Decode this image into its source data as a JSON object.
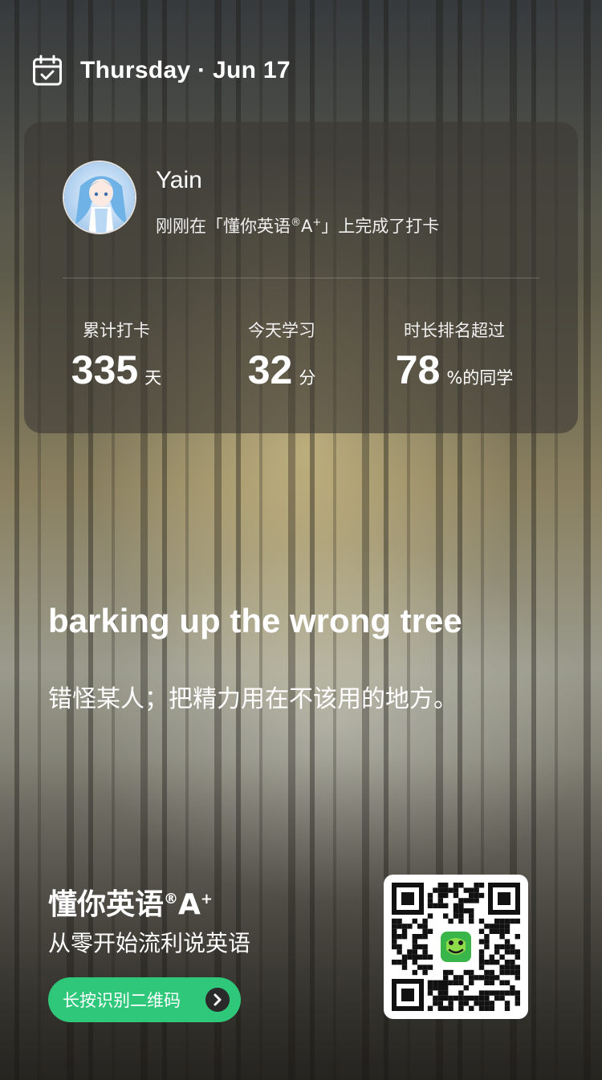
{
  "header": {
    "date": "Thursday · Jun 17",
    "icon": "calendar-check-icon"
  },
  "profile": {
    "name": "Yain",
    "status_prefix": "刚刚在「懂你英语",
    "status_mark": "®",
    "status_grade": "A",
    "status_plus": "+",
    "status_suffix": "」上完成了打卡"
  },
  "stats": [
    {
      "label": "累计打卡",
      "value": "335",
      "unit": "天"
    },
    {
      "label": "今天学习",
      "value": "32",
      "unit": "分"
    },
    {
      "label": "时长排名超过",
      "value": "78",
      "unit": "%的同学"
    }
  ],
  "phrase": {
    "text": "barking up the wrong tree",
    "meaning": "错怪某人；把精力用在不该用的地方。"
  },
  "footer": {
    "brand_name": "懂你英语",
    "brand_mark": "®",
    "brand_grade": "A",
    "brand_plus": "+",
    "slogan": "从零开始流利说英语",
    "cta_label": "长按识别二维码"
  },
  "colors": {
    "accent_green": "#2fc77a",
    "card_bg": "rgba(60,56,52,0.62)"
  }
}
